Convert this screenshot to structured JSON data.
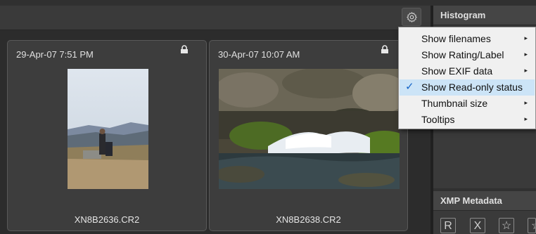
{
  "toolbar": {
    "settings_icon": "gear-icon"
  },
  "thumbnails": [
    {
      "date": "29-Apr-07 7:51 PM",
      "filename": "XN8B2636.CR2",
      "read_only": true
    },
    {
      "date": "30-Apr-07 10:07 AM",
      "filename": "XN8B2638.CR2",
      "read_only": true
    }
  ],
  "panels": {
    "histogram": {
      "title": "Histogram"
    },
    "xmp": {
      "title": "XMP Metadata",
      "buttons": [
        "R",
        "X",
        "☆",
        "☆"
      ]
    }
  },
  "menu": {
    "items": [
      {
        "label": "Show filenames",
        "submenu": true,
        "checked": false
      },
      {
        "label": "Show Rating/Label",
        "submenu": true,
        "checked": false
      },
      {
        "label": "Show EXIF data",
        "submenu": true,
        "checked": false
      },
      {
        "label": "Show Read-only status",
        "submenu": false,
        "checked": true
      },
      {
        "label": "Thumbnail size",
        "submenu": true,
        "checked": false
      },
      {
        "label": "Tooltips",
        "submenu": true,
        "checked": false
      }
    ],
    "check_glyph": "✓",
    "arrow_glyph": "▸"
  },
  "colors": {
    "accent": "#1464c8",
    "menu_highlight": "#cce4f7",
    "background": "#303030"
  }
}
